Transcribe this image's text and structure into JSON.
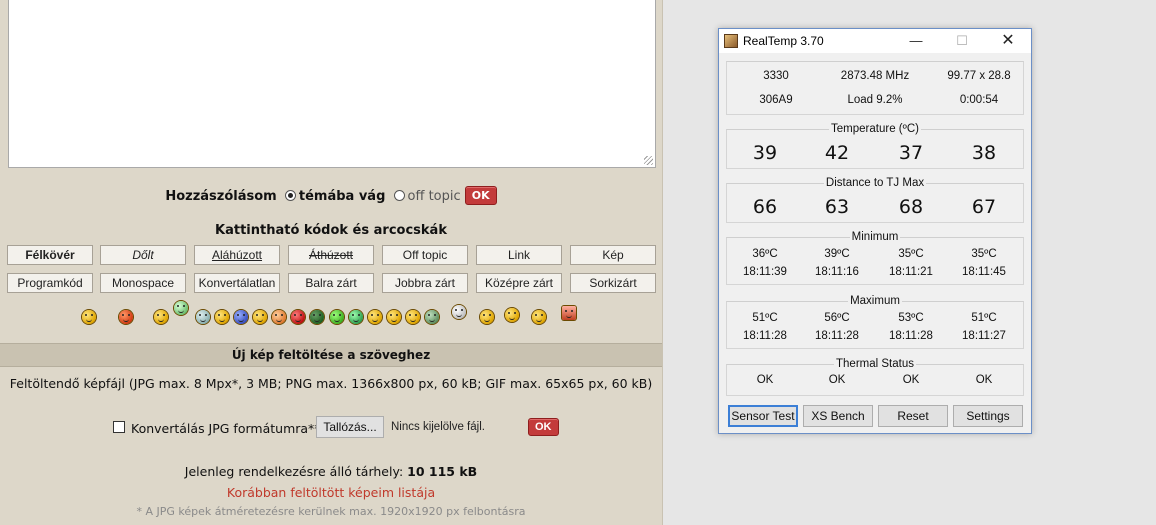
{
  "forum": {
    "reply": {
      "label": "Hozzászólásom",
      "option_topic": "témába vág",
      "option_offtopic": "off topic",
      "ok": "OK"
    },
    "codes_title": "Kattintható kódok és arcocskák",
    "code_buttons_row1": [
      "Félkövér",
      "Dőlt",
      "Aláhúzott",
      "Áthúzott",
      "Off topic",
      "Link",
      "Kép"
    ],
    "code_buttons_row2": [
      "Programkód",
      "Monospace",
      "Konvertálatlan",
      "Balra zárt",
      "Jobbra zárt",
      "Középre zárt",
      "Sorkizárt"
    ],
    "upload_header": "Új kép feltöltése a szöveghez",
    "upload_info": "Feltöltendő képfájl (JPG max. 8 Mpx*, 3 MB; PNG max. 1366x800 px, 60 kB; GIF max. 65x65 px, 60 kB)",
    "convert_label": "Konvertálás JPG formátumra**",
    "browse_label": "Tallózás...",
    "no_file": "Nincs kijelölve fájl.",
    "upload_ok": "OK",
    "storage_label": "Jelenleg rendelkezésre álló tárhely:",
    "storage_value": "10 115 kB",
    "prev_link": "Korábban feltöltött képeim listája",
    "jpg_note": "* A JPG képek átméretezésre kerülnek max. 1920x1920 px felbontásra"
  },
  "realtemp": {
    "title": "RealTemp 3.70",
    "info": {
      "r1": [
        "3330",
        "2873.48 MHz",
        "99.77 x 28.8"
      ],
      "r2": [
        "306A9",
        "Load  9.2%",
        "0:00:54"
      ]
    },
    "temperature": {
      "title": "Temperature (ºC)",
      "values": [
        "39",
        "42",
        "37",
        "38"
      ]
    },
    "distance": {
      "title": "Distance to TJ Max",
      "values": [
        "66",
        "63",
        "68",
        "67"
      ]
    },
    "minimum": {
      "title": "Minimum",
      "temps": [
        "36ºC",
        "39ºC",
        "35ºC",
        "35ºC"
      ],
      "times": [
        "18:11:39",
        "18:11:16",
        "18:11:21",
        "18:11:45"
      ]
    },
    "maximum": {
      "title": "Maximum",
      "temps": [
        "51ºC",
        "56ºC",
        "53ºC",
        "51ºC"
      ],
      "times": [
        "18:11:28",
        "18:11:28",
        "18:11:28",
        "18:11:27"
      ]
    },
    "thermal": {
      "title": "Thermal Status",
      "values": [
        "OK",
        "OK",
        "OK",
        "OK"
      ]
    },
    "buttons": {
      "sensor_test": "Sensor Test",
      "xs_bench": "XS Bench",
      "reset": "Reset",
      "settings": "Settings"
    }
  },
  "icons": {
    "window_icon": "realtemp-app-icon",
    "minimize": "minimize-icon",
    "maximize": "maximize-icon",
    "close": "close-icon"
  }
}
